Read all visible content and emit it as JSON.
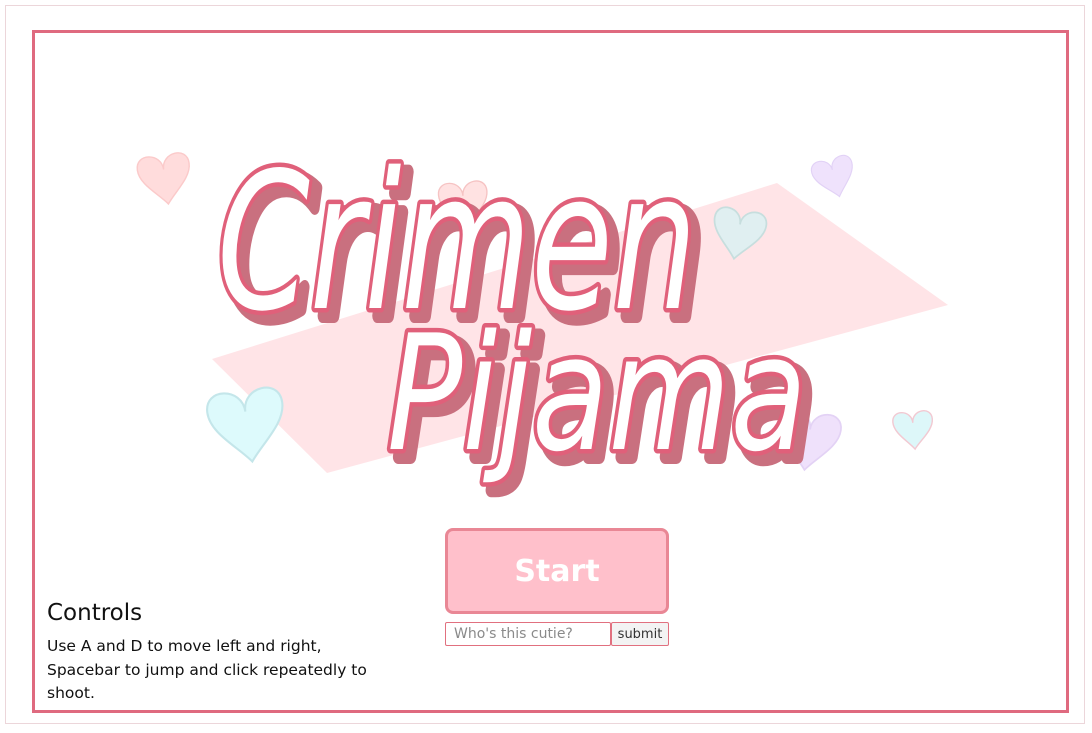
{
  "game": {
    "title_line1": "Crimen",
    "title_line2": "Pijama"
  },
  "menu": {
    "start_label": "Start",
    "name_placeholder": "Who's this cutie?",
    "name_value": "",
    "submit_label": "submit"
  },
  "controls": {
    "heading": "Controls",
    "description": "Use A and D to move left and right, Spacebar to jump and click repeatedly to shoot."
  },
  "colors": {
    "frame_border": "#df6a7f",
    "title_outline": "#e0607a",
    "title_shadow": "#c9707f",
    "start_fill": "#ffc0cb",
    "start_border": "#e98795",
    "banner": "#ffe1e4",
    "heart_pink": "#ffd6d8",
    "heart_blue": "#dcf6f8",
    "heart_purple": "#eee0fb"
  }
}
